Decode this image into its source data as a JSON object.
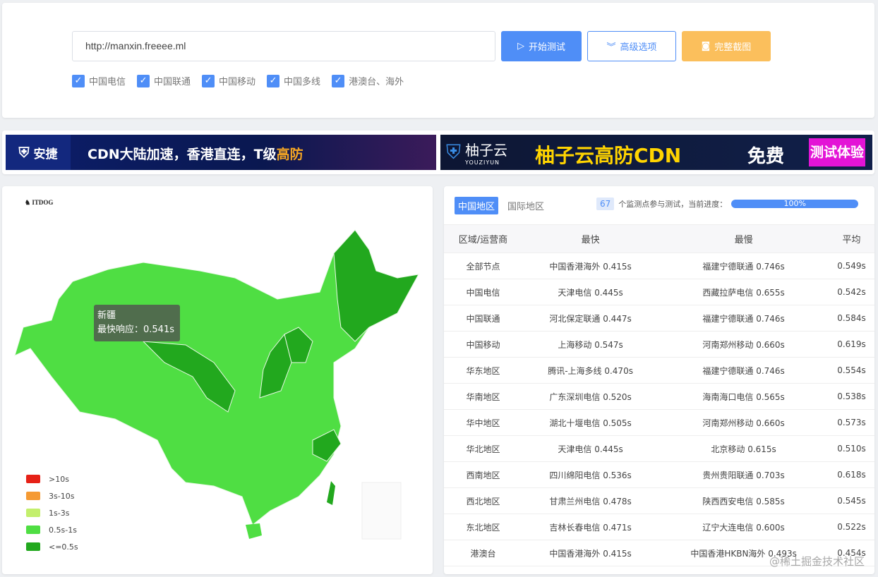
{
  "search": {
    "url": "http://manxin.freeee.ml"
  },
  "buttons": {
    "start": "开始测试",
    "advanced": "高级选项",
    "screenshot": "完整截图"
  },
  "checkboxes": [
    "中国电信",
    "中国联通",
    "中国移动",
    "中国多线",
    "港澳台、海外"
  ],
  "ads": {
    "ad1_brand": "安捷",
    "ad1_text": "CDN大陆加速，香港直连，T级",
    "ad1_hl": "高防",
    "ad2_brand": "柚子云",
    "ad2_sub": "YOUZIYUN",
    "ad2_text": "柚子云高防CDN",
    "ad2_free": "免费",
    "ad2_try": "测试体验"
  },
  "map": {
    "logo": "ITDOG",
    "tooltip_region": "新疆",
    "tooltip_value": "最快响应：0.541s",
    "legend": [
      {
        "label": ">10s",
        "color": "#e62117"
      },
      {
        "label": "3s-10s",
        "color": "#f59a33"
      },
      {
        "label": "1s-3s",
        "color": "#c3ef6c"
      },
      {
        "label": "0.5s-1s",
        "color": "#4fde43"
      },
      {
        "label": "<=0.5s",
        "color": "#22a81e"
      }
    ]
  },
  "stats": {
    "tab_cn": "中国地区",
    "tab_intl": "国际地区",
    "count": "67",
    "count_text": "个监测点参与测试，当前进度：",
    "progress": "100%",
    "headers": [
      "区域/运营商",
      "最快",
      "最慢",
      "平均"
    ],
    "rows": [
      [
        "全部节点",
        "中国香港海外 0.415s",
        "福建宁德联通 0.746s",
        "0.549s"
      ],
      [
        "中国电信",
        "天津电信 0.445s",
        "西藏拉萨电信 0.655s",
        "0.542s"
      ],
      [
        "中国联通",
        "河北保定联通 0.447s",
        "福建宁德联通 0.746s",
        "0.584s"
      ],
      [
        "中国移动",
        "上海移动 0.547s",
        "河南郑州移动 0.660s",
        "0.619s"
      ],
      [
        "华东地区",
        "腾讯-上海多线 0.470s",
        "福建宁德联通 0.746s",
        "0.554s"
      ],
      [
        "华南地区",
        "广东深圳电信 0.520s",
        "海南海口电信 0.565s",
        "0.538s"
      ],
      [
        "华中地区",
        "湖北十堰电信 0.505s",
        "河南郑州移动 0.660s",
        "0.573s"
      ],
      [
        "华北地区",
        "天津电信 0.445s",
        "北京移动 0.615s",
        "0.510s"
      ],
      [
        "西南地区",
        "四川绵阳电信 0.536s",
        "贵州贵阳联通 0.703s",
        "0.618s"
      ],
      [
        "西北地区",
        "甘肃兰州电信 0.478s",
        "陕西西安电信 0.585s",
        "0.545s"
      ],
      [
        "东北地区",
        "吉林长春电信 0.471s",
        "辽宁大连电信 0.600s",
        "0.522s"
      ],
      [
        "港澳台",
        "中国香港海外 0.415s",
        "中国香港HKBN海外 0.493s",
        "0.454s"
      ]
    ]
  },
  "watermark": "@稀土掘金技术社区"
}
